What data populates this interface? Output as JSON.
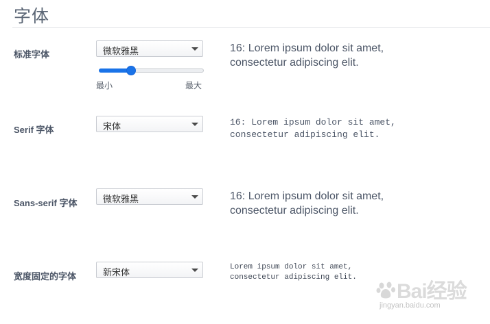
{
  "page": {
    "title": "字体"
  },
  "rows": [
    {
      "label": "标准字体",
      "select_value": "微软雅黑",
      "preview_line1": "16: Lorem ipsum dolor sit amet,",
      "preview_line2": "consectetur adipiscing elit."
    },
    {
      "label": "Serif 字体",
      "select_value": "宋体",
      "preview_line1": "16: Lorem ipsum dolor sit amet,",
      "preview_line2": "consectetur adipiscing elit."
    },
    {
      "label": "Sans-serif 字体",
      "select_value": "微软雅黑",
      "preview_line1": "16: Lorem ipsum dolor sit amet,",
      "preview_line2": "consectetur adipiscing elit."
    },
    {
      "label": "宽度固定的字体",
      "select_value": "新宋体",
      "preview_line1": "Lorem ipsum dolor sit amet,",
      "preview_line2": "consectetur adipiscing elit."
    }
  ],
  "font_size_slider": {
    "min_label": "最小",
    "max_label": "最大",
    "level": 0.31,
    "accent_color": "#1a73e8"
  },
  "watermark": {
    "logo": "Bai经验",
    "url": "jingyan.baidu.com",
    "icon": "baidu-paw-icon"
  }
}
